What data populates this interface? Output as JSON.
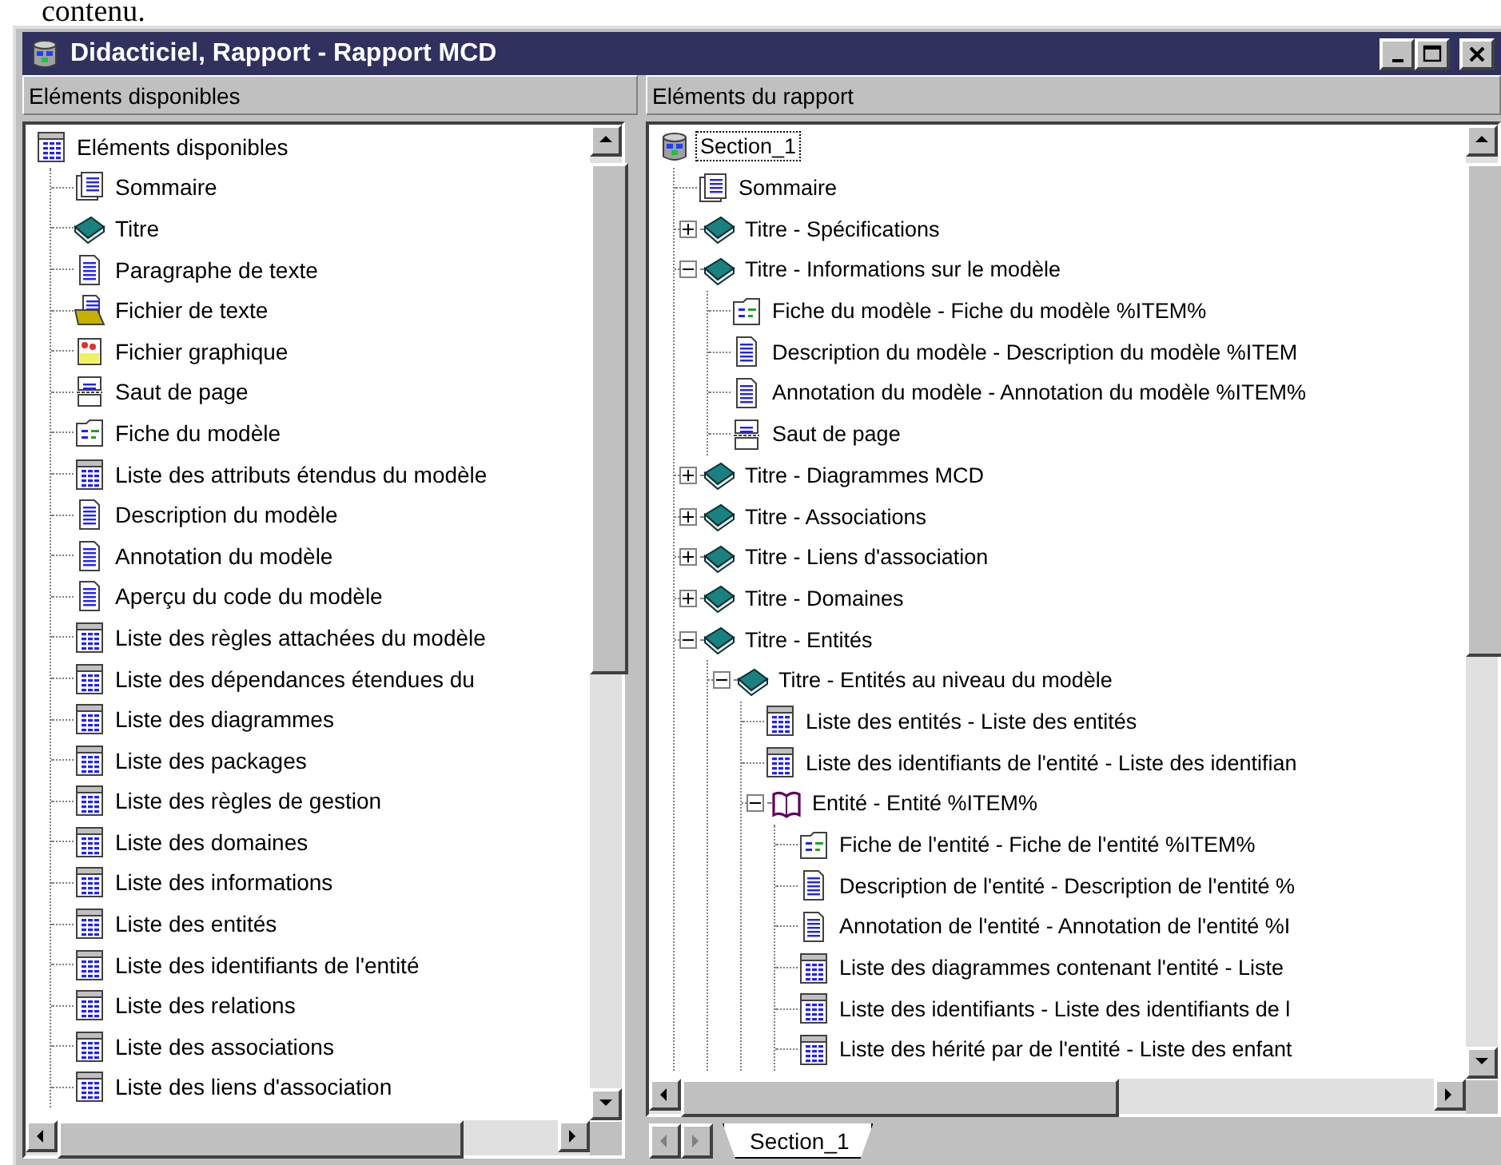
{
  "caption": "contenu.",
  "window": {
    "title": "Didacticiel, Rapport - Rapport MCD"
  },
  "available": {
    "header": "Eléments disponibles",
    "root": {
      "label": "Eléments disponibles",
      "kind": "list",
      "selected": false,
      "children": [
        {
          "label": "Sommaire",
          "kind": "summary",
          "selected": false
        },
        {
          "label": "Titre",
          "kind": "book",
          "selected": false
        },
        {
          "label": "Paragraphe de texte",
          "kind": "paragraph",
          "selected": false
        },
        {
          "label": "Fichier de texte",
          "kind": "textfile",
          "selected": false
        },
        {
          "label": "Fichier graphique",
          "kind": "graphic",
          "selected": false
        },
        {
          "label": "Saut de page",
          "kind": "pagebreak",
          "selected": false
        },
        {
          "label": "Fiche du modèle",
          "kind": "sheet",
          "selected": false
        },
        {
          "label": "Liste des attributs étendus du modèle",
          "kind": "list",
          "selected": false
        },
        {
          "label": "Description du modèle",
          "kind": "paragraph",
          "selected": false
        },
        {
          "label": "Annotation du modèle",
          "kind": "paragraph",
          "selected": false
        },
        {
          "label": "Aperçu du code du modèle",
          "kind": "paragraph",
          "selected": false
        },
        {
          "label": "Liste des règles attachées du modèle",
          "kind": "list",
          "selected": false
        },
        {
          "label": "Liste des dépendances étendues du",
          "kind": "list",
          "selected": false
        },
        {
          "label": "Liste des diagrammes",
          "kind": "list",
          "selected": false
        },
        {
          "label": "Liste des packages",
          "kind": "list",
          "selected": false
        },
        {
          "label": "Liste des règles de gestion",
          "kind": "list",
          "selected": false
        },
        {
          "label": "Liste des domaines",
          "kind": "list",
          "selected": false
        },
        {
          "label": "Liste des informations",
          "kind": "list",
          "selected": false
        },
        {
          "label": "Liste des entités",
          "kind": "list",
          "selected": false
        },
        {
          "label": "Liste des identifiants de l'entité",
          "kind": "list",
          "selected": false
        },
        {
          "label": "Liste des relations",
          "kind": "list",
          "selected": false
        },
        {
          "label": "Liste des associations",
          "kind": "list",
          "selected": false
        },
        {
          "label": "Liste des liens d'association",
          "kind": "list",
          "selected": false
        }
      ]
    }
  },
  "report": {
    "header": "Eléments du rapport",
    "root": {
      "label": "Section_1",
      "kind": "section",
      "selected": true,
      "children": [
        {
          "label": "Sommaire",
          "kind": "summary",
          "selected": false
        },
        {
          "label": "Titre - Spécifications",
          "kind": "book",
          "selected": false,
          "expanded": false
        },
        {
          "label": "Titre - Informations sur le modèle",
          "kind": "book",
          "selected": false,
          "expanded": true,
          "children": [
            {
              "label": "Fiche du modèle - Fiche du modèle %ITEM%",
              "kind": "sheet",
              "selected": false
            },
            {
              "label": "Description du modèle - Description du modèle %ITEM",
              "kind": "paragraph",
              "selected": false
            },
            {
              "label": "Annotation du modèle - Annotation du modèle %ITEM%",
              "kind": "paragraph",
              "selected": false
            },
            {
              "label": "Saut de page",
              "kind": "pagebreak",
              "selected": false
            }
          ]
        },
        {
          "label": "Titre - Diagrammes MCD",
          "kind": "book",
          "selected": false,
          "expanded": false
        },
        {
          "label": "Titre - Associations",
          "kind": "book",
          "selected": false,
          "expanded": false
        },
        {
          "label": "Titre - Liens d'association",
          "kind": "book",
          "selected": false,
          "expanded": false
        },
        {
          "label": "Titre - Domaines",
          "kind": "book",
          "selected": false,
          "expanded": false
        },
        {
          "label": "Titre - Entités",
          "kind": "book",
          "selected": false,
          "expanded": true,
          "children": [
            {
              "label": "Titre - Entités au niveau du modèle",
              "kind": "book",
              "selected": false,
              "expanded": true,
              "children": [
                {
                  "label": "Liste des entités - Liste des entités",
                  "kind": "list",
                  "selected": false
                },
                {
                  "label": "Liste des identifiants de l'entité - Liste des identifian",
                  "kind": "list",
                  "selected": false
                },
                {
                  "label": "Entité - Entité %ITEM%",
                  "kind": "entity",
                  "selected": false,
                  "expanded": true,
                  "children": [
                    {
                      "label": "Fiche de l'entité - Fiche de l'entité %ITEM%",
                      "kind": "sheet",
                      "selected": false
                    },
                    {
                      "label": "Description de l'entité - Description de l'entité %",
                      "kind": "paragraph",
                      "selected": false
                    },
                    {
                      "label": "Annotation de l'entité - Annotation de l'entité %I",
                      "kind": "paragraph",
                      "selected": false
                    },
                    {
                      "label": "Liste des diagrammes contenant l'entité - Liste",
                      "kind": "list",
                      "selected": false
                    },
                    {
                      "label": "Liste des identifiants - Liste des identifiants de l",
                      "kind": "list",
                      "selected": false
                    },
                    {
                      "label": "Liste des hérité par de l'entité - Liste des enfant",
                      "kind": "list",
                      "selected": false
                    }
                  ]
                }
              ]
            }
          ]
        }
      ]
    },
    "tabs": [
      {
        "label": "Section_1",
        "selected": true
      }
    ]
  }
}
